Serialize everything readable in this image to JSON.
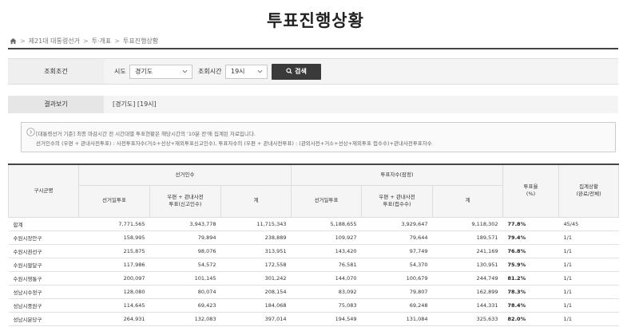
{
  "page": {
    "title": "투표진행상황"
  },
  "breadcrumb": [
    "제21대 대통령선거",
    "투·개표",
    "투표진행상황"
  ],
  "search": {
    "section_label": "조회조건",
    "region_label": "시도",
    "region_value": "경기도",
    "time_label": "조회시간",
    "time_value": "19시",
    "button_label": "검색"
  },
  "result": {
    "section_label": "결과보기",
    "value": "[경기도] [19시]"
  },
  "notice": {
    "line1": "[대통령선거 기준] 최종 마감시간 전 시간대별 투표현황은 해당시간의 '10분 전'에 집계된 자료입니다.",
    "line2": "선거인수의 (우편 + 관내사전투표) : 사전투표자수(거소+선상+재외투표신고인수), 투표자수의 (우편 + 관내사전투표) : (관외사전+거소+선상+재외투표 접수수)+관내사전투표자수"
  },
  "table": {
    "col_district": "구시군명",
    "group_electors": "선거인수",
    "group_voters": "투표자수(잠정)",
    "col_electors_day": "선거일투표",
    "col_electors_mail": "우편 + 관내사전\n투표(신고인수)",
    "col_electors_total": "계",
    "col_voters_day": "선거일투표",
    "col_voters_mail": "우편 + 관내사전\n투표(접수수)",
    "col_voters_total": "계",
    "col_rate": "투표율\n(%)",
    "col_status": "집계상황\n(완료/전체)",
    "rows": [
      {
        "name": "합계",
        "e_day": "7,771,565",
        "e_mail": "3,943,778",
        "e_total": "11,715,343",
        "v_day": "5,188,655",
        "v_mail": "3,929,647",
        "v_total": "9,118,302",
        "rate": "77.8%",
        "status": "45/45"
      },
      {
        "name": "수원시장안구",
        "e_day": "158,995",
        "e_mail": "79,894",
        "e_total": "238,889",
        "v_day": "109,927",
        "v_mail": "79,644",
        "v_total": "189,571",
        "rate": "79.4%",
        "status": "1/1"
      },
      {
        "name": "수원시권선구",
        "e_day": "215,875",
        "e_mail": "98,076",
        "e_total": "313,951",
        "v_day": "143,420",
        "v_mail": "97,749",
        "v_total": "241,169",
        "rate": "76.8%",
        "status": "1/1"
      },
      {
        "name": "수원시팔달구",
        "e_day": "117,986",
        "e_mail": "54,572",
        "e_total": "172,558",
        "v_day": "76,581",
        "v_mail": "54,370",
        "v_total": "130,951",
        "rate": "75.9%",
        "status": "1/1"
      },
      {
        "name": "수원시영통구",
        "e_day": "200,097",
        "e_mail": "101,145",
        "e_total": "301,242",
        "v_day": "144,070",
        "v_mail": "100,679",
        "v_total": "244,749",
        "rate": "81.2%",
        "status": "1/1"
      },
      {
        "name": "성남시수정구",
        "e_day": "128,080",
        "e_mail": "80,074",
        "e_total": "208,154",
        "v_day": "83,092",
        "v_mail": "79,807",
        "v_total": "162,899",
        "rate": "78.3%",
        "status": "1/1"
      },
      {
        "name": "성남시중원구",
        "e_day": "114,645",
        "e_mail": "69,423",
        "e_total": "184,068",
        "v_day": "75,083",
        "v_mail": "69,248",
        "v_total": "144,331",
        "rate": "78.4%",
        "status": "1/1"
      },
      {
        "name": "성남시분당구",
        "e_day": "264,931",
        "e_mail": "132,083",
        "e_total": "397,014",
        "v_day": "194,549",
        "v_mail": "131,084",
        "v_total": "325,633",
        "rate": "82.0%",
        "status": "1/1"
      }
    ]
  }
}
